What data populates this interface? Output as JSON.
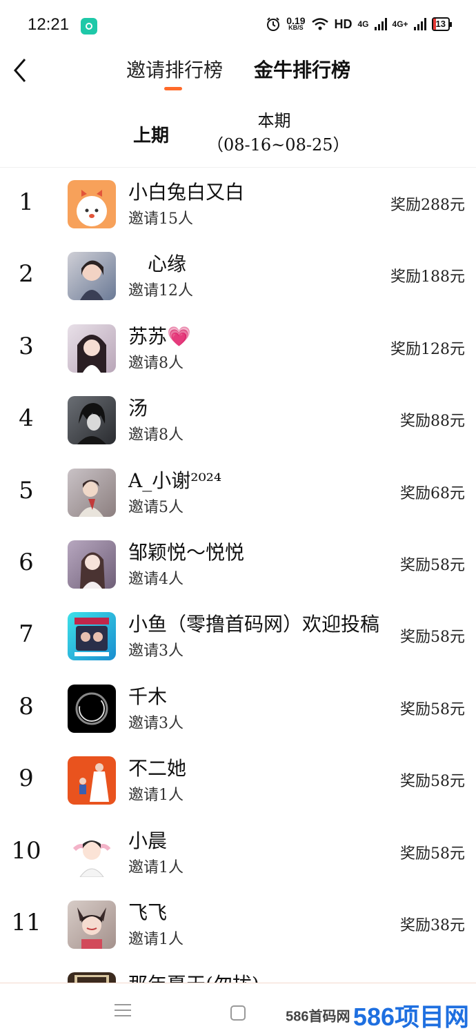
{
  "status_bar": {
    "time": "12:21",
    "net_speed_value": "0.19",
    "net_speed_unit": "KB/S",
    "hd_label": "HD",
    "signal_1": "4G",
    "signal_2": "4G+",
    "battery": "13"
  },
  "header": {
    "tab_invite_rank": "邀请排行榜",
    "tab_golden_bull_rank": "金牛排行榜"
  },
  "period": {
    "prev_label": "上期",
    "current_label": "本期",
    "current_range": "（08-16~08-25）"
  },
  "ranking": [
    {
      "rank": "1",
      "name": "小白兔白又白",
      "invites": "邀请15人",
      "reward": "奖励288元"
    },
    {
      "rank": "2",
      "name": "　心缘",
      "invites": "邀请12人",
      "reward": "奖励188元"
    },
    {
      "rank": "3",
      "name": "苏苏💗",
      "invites": "邀请8人",
      "reward": "奖励128元"
    },
    {
      "rank": "4",
      "name": "汤",
      "invites": "邀请8人",
      "reward": "奖励88元"
    },
    {
      "rank": "5",
      "name": "A_小谢²⁰²⁴",
      "invites": "邀请5人",
      "reward": "奖励68元"
    },
    {
      "rank": "6",
      "name": "邹颖悦～悦悦",
      "invites": "邀请4人",
      "reward": "奖励58元"
    },
    {
      "rank": "7",
      "name": "小鱼（零撸首码网）欢迎投稿",
      "invites": "邀请3人",
      "reward": "奖励58元"
    },
    {
      "rank": "8",
      "name": "千木",
      "invites": "邀请3人",
      "reward": "奖励58元"
    },
    {
      "rank": "9",
      "name": "不二她",
      "invites": "邀请1人",
      "reward": "奖励58元"
    },
    {
      "rank": "10",
      "name": "小晨",
      "invites": "邀请1人",
      "reward": "奖励58元"
    },
    {
      "rank": "11",
      "name": "飞飞",
      "invites": "邀请1人",
      "reward": "奖励38元"
    },
    {
      "rank": "",
      "name": "那年夏天(勿扰)",
      "invites": "",
      "reward": ""
    }
  ],
  "watermark": {
    "small": "586首码网",
    "big": "586项目网"
  }
}
